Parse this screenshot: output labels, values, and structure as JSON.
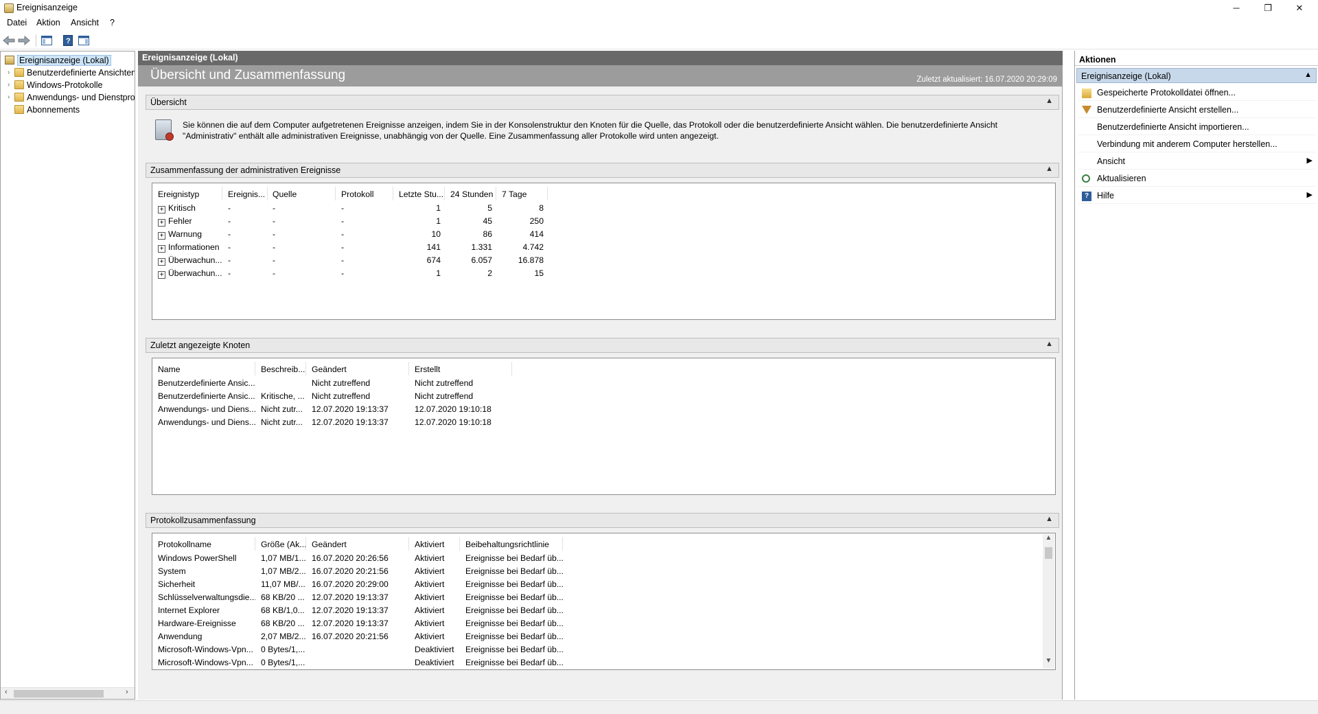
{
  "window": {
    "title": "Ereignisanzeige",
    "minimize": "─",
    "maximize": "❐",
    "close": "✕"
  },
  "menu": [
    "Datei",
    "Aktion",
    "Ansicht",
    "?"
  ],
  "toolbar": {
    "back": "🡄",
    "forward": "🡆",
    "help": "?"
  },
  "tree": {
    "root": "Ereignisanzeige (Lokal)",
    "items": [
      "Benutzerdefinierte Ansichten",
      "Windows-Protokolle",
      "Anwendungs- und Dienstprotokolle",
      "Abonnements"
    ]
  },
  "center": {
    "header": "Ereignisanzeige (Lokal)",
    "banner_title": "Übersicht und Zusammenfassung",
    "updated": "Zuletzt aktualisiert: 16.07.2020 20:29:09",
    "overview": {
      "title": "Übersicht",
      "text": "Sie können die auf dem Computer aufgetretenen Ereignisse anzeigen, indem Sie in der Konsolenstruktur den Knoten für die Quelle, das Protokoll oder die benutzerdefinierte Ansicht wählen. Die benutzerdefinierte Ansicht \"Administrativ\" enthält alle administrativen Ereignisse, unabhängig von der Quelle. Eine Zusammenfassung aller Protokolle wird unten angezeigt."
    },
    "admin_summary": {
      "title": "Zusammenfassung der administrativen Ereignisse",
      "columns": [
        "Ereignistyp",
        "Ereignis...",
        "Quelle",
        "Protokoll",
        "Letzte Stu...",
        "24 Stunden",
        "7 Tage"
      ],
      "rows": [
        [
          "Kritisch",
          "-",
          "-",
          "-",
          "1",
          "5",
          "8"
        ],
        [
          "Fehler",
          "-",
          "-",
          "-",
          "1",
          "45",
          "250"
        ],
        [
          "Warnung",
          "-",
          "-",
          "-",
          "10",
          "86",
          "414"
        ],
        [
          "Informationen",
          "-",
          "-",
          "-",
          "141",
          "1.331",
          "4.742"
        ],
        [
          "Überwachun...",
          "-",
          "-",
          "-",
          "674",
          "6.057",
          "16.878"
        ],
        [
          "Überwachun...",
          "-",
          "-",
          "-",
          "1",
          "2",
          "15"
        ]
      ]
    },
    "recent_nodes": {
      "title": "Zuletzt angezeigte Knoten",
      "columns": [
        "Name",
        "Beschreib...",
        "Geändert",
        "Erstellt"
      ],
      "rows": [
        [
          "Benutzerdefinierte Ansic...",
          "",
          "Nicht zutreffend",
          "Nicht zutreffend"
        ],
        [
          "Benutzerdefinierte Ansic...",
          "Kritische, ...",
          "Nicht zutreffend",
          "Nicht zutreffend"
        ],
        [
          "Anwendungs- und Diens...",
          "Nicht zutr...",
          "12.07.2020 19:13:37",
          "12.07.2020 19:10:18"
        ],
        [
          "Anwendungs- und Diens...",
          "Nicht zutr...",
          "12.07.2020 19:13:37",
          "12.07.2020 19:10:18"
        ]
      ]
    },
    "log_summary": {
      "title": "Protokollzusammenfassung",
      "columns": [
        "Protokollname",
        "Größe (Ak...",
        "Geändert",
        "Aktiviert",
        "Beibehaltungsrichtlinie"
      ],
      "rows": [
        [
          "Windows PowerShell",
          "1,07 MB/1...",
          "16.07.2020 20:26:56",
          "Aktiviert",
          "Ereignisse bei Bedarf üb..."
        ],
        [
          "System",
          "1,07 MB/2...",
          "16.07.2020 20:21:56",
          "Aktiviert",
          "Ereignisse bei Bedarf üb..."
        ],
        [
          "Sicherheit",
          "11,07 MB/...",
          "16.07.2020 20:29:00",
          "Aktiviert",
          "Ereignisse bei Bedarf üb..."
        ],
        [
          "Schlüsselverwaltungsdie...",
          "68 KB/20 ...",
          "12.07.2020 19:13:37",
          "Aktiviert",
          "Ereignisse bei Bedarf üb..."
        ],
        [
          "Internet Explorer",
          "68 KB/1,0...",
          "12.07.2020 19:13:37",
          "Aktiviert",
          "Ereignisse bei Bedarf üb..."
        ],
        [
          "Hardware-Ereignisse",
          "68 KB/20 ...",
          "12.07.2020 19:13:37",
          "Aktiviert",
          "Ereignisse bei Bedarf üb..."
        ],
        [
          "Anwendung",
          "2,07 MB/2...",
          "16.07.2020 20:21:56",
          "Aktiviert",
          "Ereignisse bei Bedarf üb..."
        ],
        [
          "Microsoft-Windows-Vpn...",
          "0 Bytes/1,...",
          "",
          "Deaktiviert",
          "Ereignisse bei Bedarf üb..."
        ],
        [
          "Microsoft-Windows-Vpn...",
          "0 Bytes/1,...",
          "",
          "Deaktiviert",
          "Ereignisse bei Bedarf üb..."
        ]
      ]
    }
  },
  "actions": {
    "header": "Aktionen",
    "group": "Ereignisanzeige (Lokal)",
    "items": [
      {
        "label": "Gespeicherte Protokolldatei öffnen...",
        "icon": "open-log-icon"
      },
      {
        "label": "Benutzerdefinierte Ansicht erstellen...",
        "icon": "filter-icon"
      },
      {
        "label": "Benutzerdefinierte Ansicht importieren...",
        "icon": ""
      },
      {
        "label": "Verbindung mit anderem Computer herstellen...",
        "icon": ""
      },
      {
        "label": "Ansicht",
        "icon": "",
        "submenu": "▶"
      },
      {
        "label": "Aktualisieren",
        "icon": "refresh-icon"
      },
      {
        "label": "Hilfe",
        "icon": "help-icon",
        "submenu": "▶"
      }
    ]
  }
}
